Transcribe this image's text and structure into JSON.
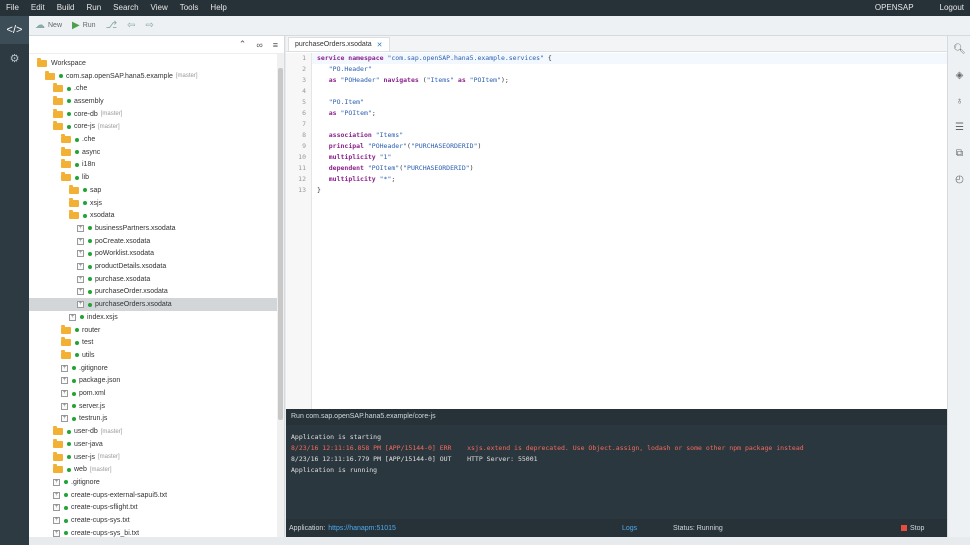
{
  "menu": {
    "items": [
      "File",
      "Edit",
      "Build",
      "Run",
      "Search",
      "View",
      "Tools",
      "Help"
    ],
    "user": "OPENSAP",
    "logout": "Logout"
  },
  "toolbar": {
    "new_label": "New",
    "run_label": "Run"
  },
  "workspace": {
    "tree": [
      {
        "label": "Workspace",
        "type": "folder",
        "indent": 0
      },
      {
        "label": "com.sap.openSAP.hana5.example",
        "type": "folder",
        "indent": 1,
        "dot": true,
        "branch": "[master]"
      },
      {
        "label": ".che",
        "type": "folder",
        "indent": 2,
        "dot": true
      },
      {
        "label": "assembly",
        "type": "folder",
        "indent": 2,
        "dot": true
      },
      {
        "label": "core-db",
        "type": "folder",
        "indent": 2,
        "dot": true,
        "branch": "[master]"
      },
      {
        "label": "core-js",
        "type": "folder",
        "indent": 2,
        "dot": true,
        "branch": "[master]"
      },
      {
        "label": ".che",
        "type": "folder",
        "indent": 3,
        "dot": true
      },
      {
        "label": "async",
        "type": "folder",
        "indent": 3,
        "dot": true
      },
      {
        "label": "i18n",
        "type": "folder",
        "indent": 3,
        "dot": true
      },
      {
        "label": "lib",
        "type": "folder",
        "indent": 3,
        "dot": true
      },
      {
        "label": "sap",
        "type": "folder",
        "indent": 4,
        "dot": true
      },
      {
        "label": "xsjs",
        "type": "folder",
        "indent": 4,
        "dot": true
      },
      {
        "label": "xsodata",
        "type": "folder",
        "indent": 4,
        "dot": true
      },
      {
        "label": "businessPartners.xsodata",
        "type": "file",
        "indent": 5,
        "dot": true
      },
      {
        "label": "poCreate.xsodata",
        "type": "file",
        "indent": 5,
        "dot": true
      },
      {
        "label": "poWorklist.xsodata",
        "type": "file",
        "indent": 5,
        "dot": true
      },
      {
        "label": "productDetails.xsodata",
        "type": "file",
        "indent": 5,
        "dot": true
      },
      {
        "label": "purchase.xsodata",
        "type": "file",
        "indent": 5,
        "dot": true
      },
      {
        "label": "purchaseOrder.xsodata",
        "type": "file",
        "indent": 5,
        "dot": true
      },
      {
        "label": "purchaseOrders.xsodata",
        "type": "file",
        "indent": 5,
        "dot": true,
        "selected": true
      },
      {
        "label": "index.xsjs",
        "type": "file",
        "indent": 4,
        "dot": true
      },
      {
        "label": "router",
        "type": "folder",
        "indent": 3,
        "dot": true
      },
      {
        "label": "test",
        "type": "folder",
        "indent": 3,
        "dot": true
      },
      {
        "label": "utils",
        "type": "folder",
        "indent": 3,
        "dot": true
      },
      {
        "label": ".gitignore",
        "type": "file",
        "indent": 3,
        "dot": true
      },
      {
        "label": "package.json",
        "type": "file",
        "indent": 3,
        "dot": true
      },
      {
        "label": "pom.xml",
        "type": "file",
        "indent": 3,
        "dot": true
      },
      {
        "label": "server.js",
        "type": "file",
        "indent": 3,
        "dot": true
      },
      {
        "label": "testrun.js",
        "type": "file",
        "indent": 3,
        "dot": true
      },
      {
        "label": "user-db",
        "type": "folder",
        "indent": 2,
        "dot": true,
        "branch": "[master]"
      },
      {
        "label": "user-java",
        "type": "folder",
        "indent": 2,
        "dot": true
      },
      {
        "label": "user-js",
        "type": "folder",
        "indent": 2,
        "dot": true,
        "branch": "[master]"
      },
      {
        "label": "web",
        "type": "folder",
        "indent": 2,
        "dot": true,
        "branch": "[master]"
      },
      {
        "label": ".gitignore",
        "type": "file",
        "indent": 2,
        "dot": true
      },
      {
        "label": "create-cups-external-sapui5.txt",
        "type": "file",
        "indent": 2,
        "dot": true
      },
      {
        "label": "create-cups-sflight.txt",
        "type": "file",
        "indent": 2,
        "dot": true
      },
      {
        "label": "create-cups-sys.txt",
        "type": "file",
        "indent": 2,
        "dot": true
      },
      {
        "label": "create-cups-sys_bi.txt",
        "type": "file",
        "indent": 2,
        "dot": true
      }
    ]
  },
  "editor": {
    "tab_label": "purchaseOrders.xsodata",
    "lines": [
      [
        {
          "t": "kw",
          "v": "service namespace "
        },
        {
          "t": "str",
          "v": "\"com.sap.openSAP.hana5.example.services\""
        },
        {
          "t": "pl",
          "v": " {"
        }
      ],
      [
        {
          "t": "pl",
          "v": "   "
        },
        {
          "t": "str",
          "v": "\"PO.Header\""
        }
      ],
      [
        {
          "t": "pl",
          "v": "   "
        },
        {
          "t": "kw",
          "v": "as "
        },
        {
          "t": "str",
          "v": "\"POHeader\""
        },
        {
          "t": "kw",
          "v": " navigates "
        },
        {
          "t": "pl",
          "v": "("
        },
        {
          "t": "str",
          "v": "\"Items\""
        },
        {
          "t": "kw",
          "v": " as "
        },
        {
          "t": "str",
          "v": "\"POItem\""
        },
        {
          "t": "pl",
          "v": ");"
        }
      ],
      [],
      [
        {
          "t": "pl",
          "v": "   "
        },
        {
          "t": "str",
          "v": "\"PO.Item\""
        }
      ],
      [
        {
          "t": "pl",
          "v": "   "
        },
        {
          "t": "kw",
          "v": "as "
        },
        {
          "t": "str",
          "v": "\"POItem\""
        },
        {
          "t": "pl",
          "v": ";"
        }
      ],
      [],
      [
        {
          "t": "pl",
          "v": "   "
        },
        {
          "t": "kw",
          "v": "association "
        },
        {
          "t": "str",
          "v": "\"Items\""
        }
      ],
      [
        {
          "t": "pl",
          "v": "   "
        },
        {
          "t": "kw",
          "v": "principal "
        },
        {
          "t": "str",
          "v": "\"POHeader\""
        },
        {
          "t": "pl",
          "v": "("
        },
        {
          "t": "str",
          "v": "\"PURCHASEORDERID\""
        },
        {
          "t": "pl",
          "v": ")"
        }
      ],
      [
        {
          "t": "pl",
          "v": "   "
        },
        {
          "t": "kw",
          "v": "multiplicity "
        },
        {
          "t": "str",
          "v": "\"1\""
        }
      ],
      [
        {
          "t": "pl",
          "v": "   "
        },
        {
          "t": "kw",
          "v": "dependent "
        },
        {
          "t": "str",
          "v": "\"POItem\""
        },
        {
          "t": "pl",
          "v": "("
        },
        {
          "t": "str",
          "v": "\"PURCHASEORDERID\""
        },
        {
          "t": "pl",
          "v": ")"
        }
      ],
      [
        {
          "t": "pl",
          "v": "   "
        },
        {
          "t": "kw",
          "v": "multiplicity "
        },
        {
          "t": "str",
          "v": "\"*\""
        },
        {
          "t": "pl",
          "v": ";"
        }
      ],
      [
        {
          "t": "pl",
          "v": "}"
        }
      ]
    ]
  },
  "console": {
    "title": "Run  com.sap.openSAP.hana5.example/core-js",
    "lines": [
      {
        "text": "Application is starting",
        "err": false
      },
      {
        "text": "8/23/16 12:11:16.858 PM [APP/15144-0] ERR    xsjs.extend is deprecated. Use Object.assign, lodash or some other npm package instead",
        "err": true
      },
      {
        "text": "8/23/16 12:11:16.779 PM [APP/15144-0] OUT    HTTP Server: 55001",
        "err": false
      },
      {
        "text": "Application is running",
        "err": false
      }
    ],
    "app_label": "Application:",
    "app_url": "https://hanapm:51015",
    "logs_label": "Logs",
    "status_label": "Status: Running",
    "stop_label": "Stop"
  },
  "colors": {
    "menubar": "#263238",
    "folder": "#f2b134",
    "dot": "#21a336",
    "selection": "#d3d6d8",
    "stop": "#e74c3c"
  }
}
